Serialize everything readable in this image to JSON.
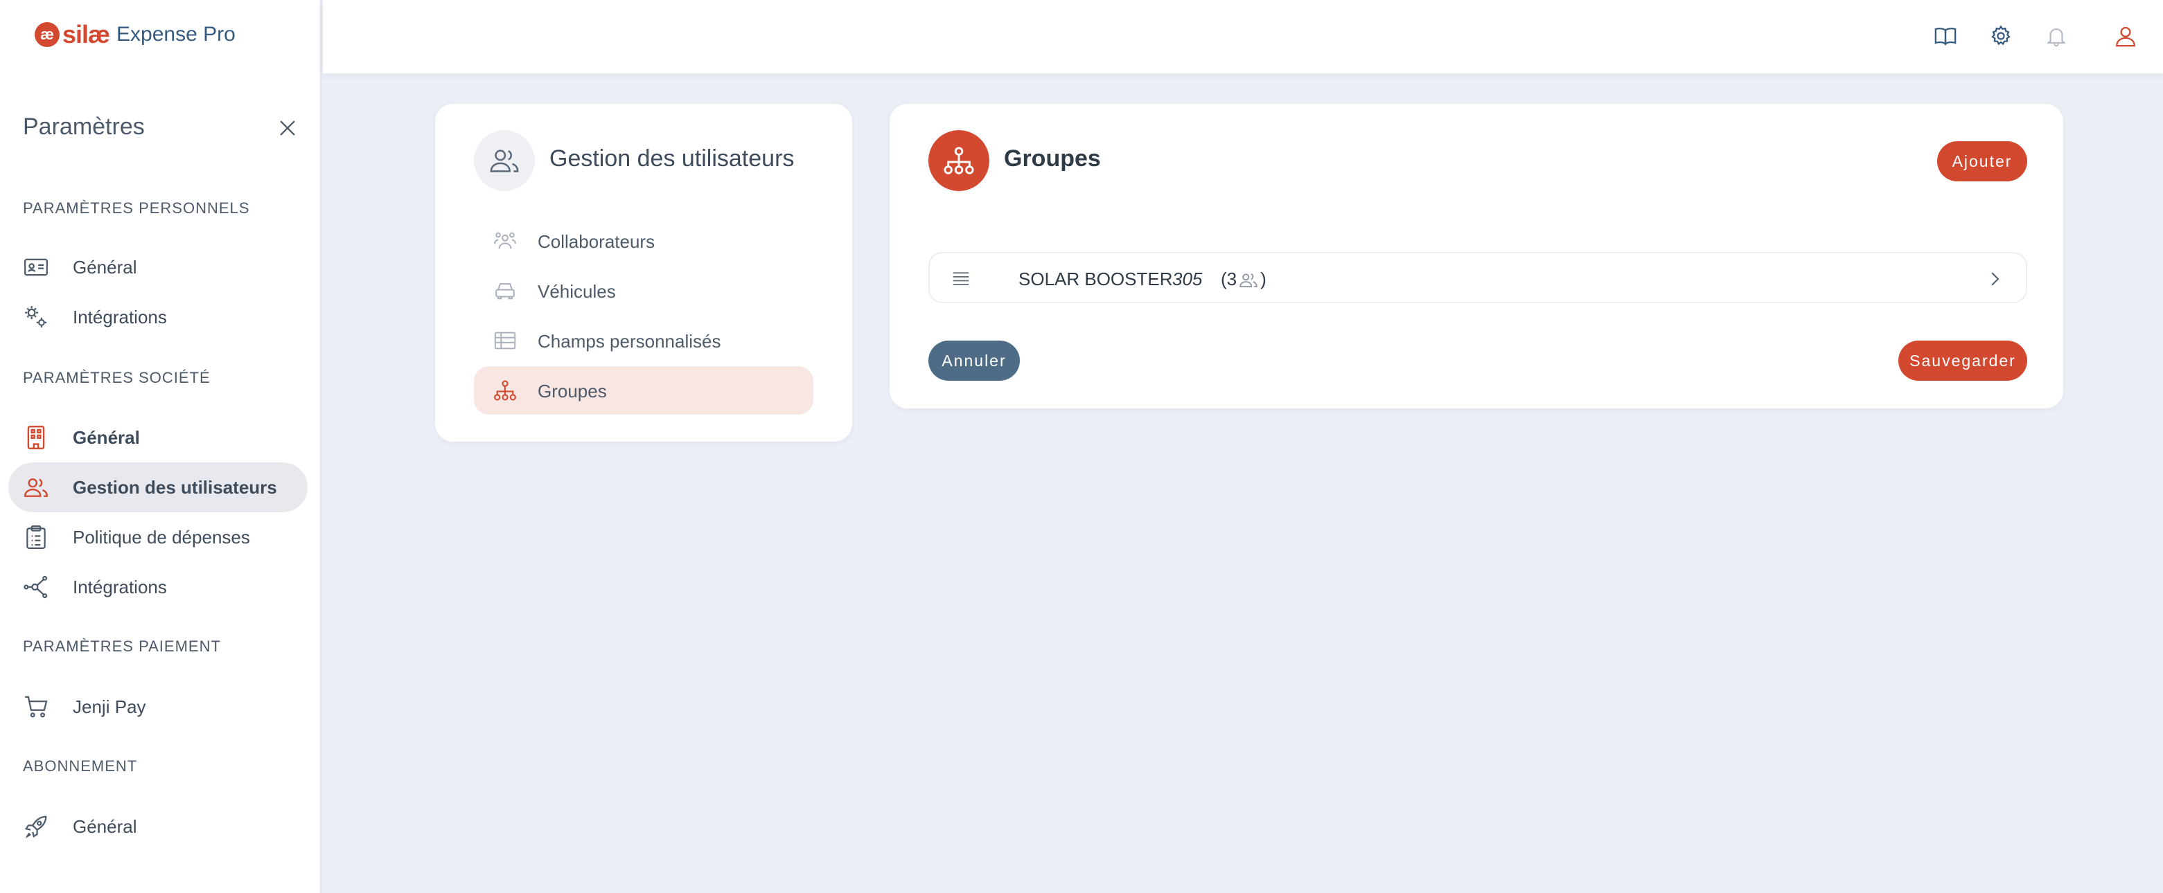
{
  "brand": {
    "mark": "æ",
    "name": "silæ",
    "product": "Expense Pro"
  },
  "sidebar": {
    "title": "Paramètres",
    "sections": {
      "personal": "PARAMÈTRES PERSONNELS",
      "company": "PARAMÈTRES SOCIÉTÉ",
      "payment": "PARAMÈTRES PAIEMENT",
      "subscription": "ABONNEMENT"
    },
    "personal_items": [
      {
        "label": "Général",
        "icon": "id-card-icon"
      },
      {
        "label": "Intégrations",
        "icon": "gears-icon"
      }
    ],
    "company_items": [
      {
        "label": "Général",
        "icon": "building-icon"
      },
      {
        "label": "Gestion des utilisateurs",
        "icon": "users-icon"
      },
      {
        "label": "Politique de dépenses",
        "icon": "clipboard-icon"
      },
      {
        "label": "Intégrations",
        "icon": "network-icon"
      }
    ],
    "payment_items": [
      {
        "label": "Jenji Pay",
        "icon": "cart-icon"
      }
    ],
    "subscription_items": [
      {
        "label": "Général",
        "icon": "rocket-icon"
      }
    ]
  },
  "topbar": {
    "icons": [
      "book-icon",
      "gear-icon",
      "bell-icon",
      "user-icon"
    ]
  },
  "user_management": {
    "title": "Gestion des utilisateurs",
    "items": [
      {
        "label": "Collaborateurs",
        "icon": "team-icon"
      },
      {
        "label": "Véhicules",
        "icon": "car-icon"
      },
      {
        "label": "Champs personnalisés",
        "icon": "table-icon"
      },
      {
        "label": "Groupes",
        "icon": "hierarchy-icon"
      }
    ]
  },
  "groups": {
    "title": "Groupes",
    "add_label": "Ajouter",
    "cancel_label": "Annuler",
    "save_label": "Sauvegarder",
    "rows": [
      {
        "name": "SOLAR BOOSTER",
        "code": "305",
        "count_prefix": "(3",
        "count_suffix": ")"
      }
    ]
  },
  "colors": {
    "accent": "#d2492f",
    "secondary": "#4e6c85",
    "active_bg": "#f8e6e2",
    "background": "#eceef6"
  }
}
